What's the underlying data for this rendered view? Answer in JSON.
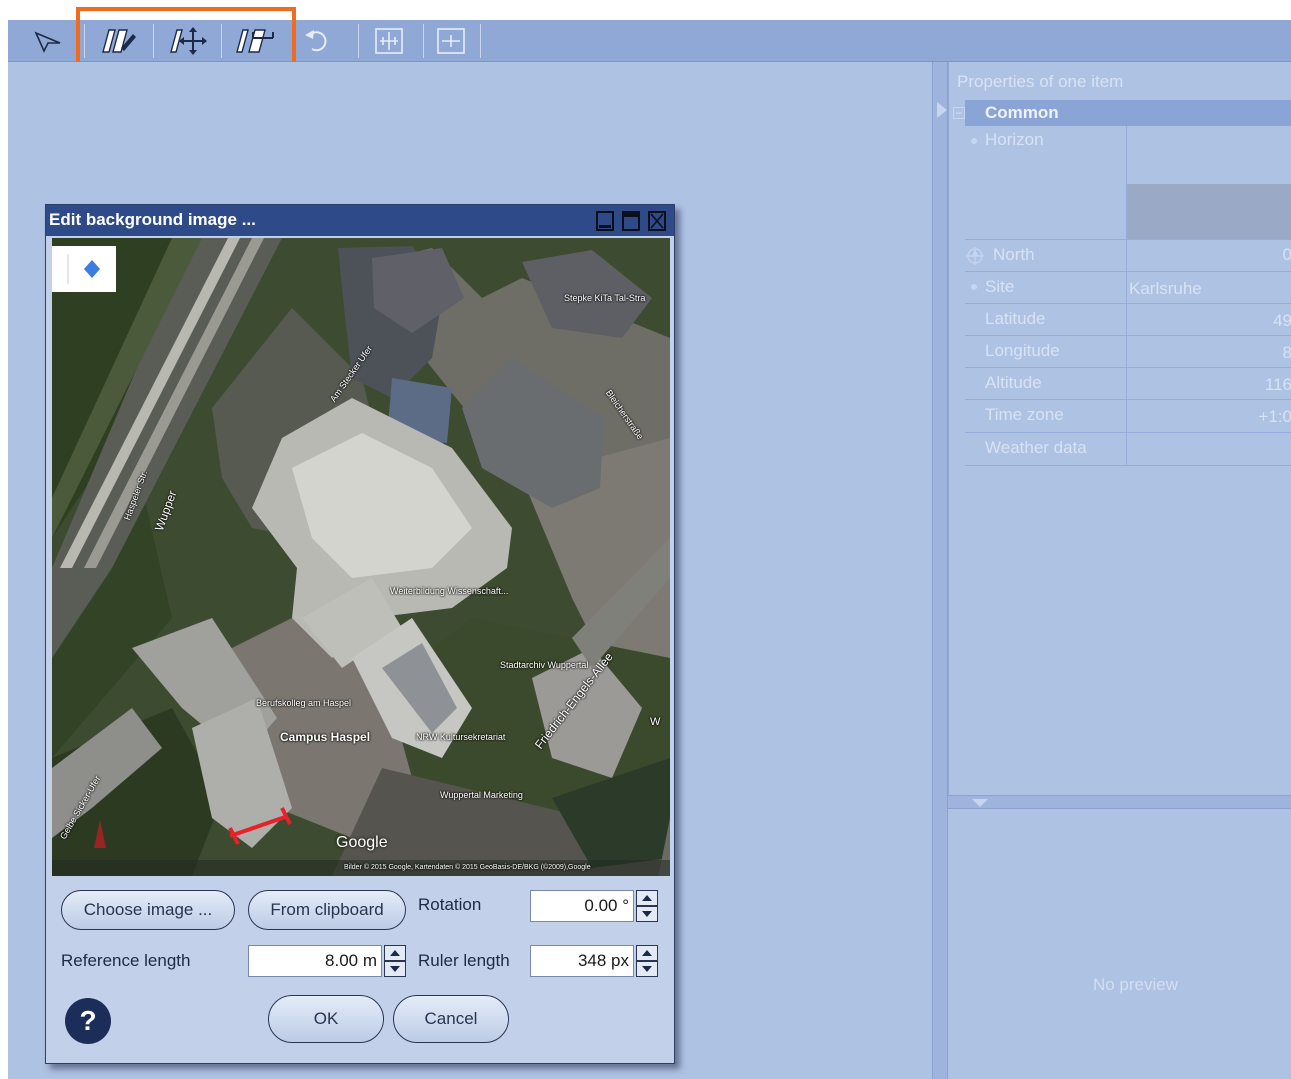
{
  "toolbar": {
    "icons": [
      "select-arrow-icon",
      "draw-wall-icon",
      "move-image-icon",
      "measure-wall-icon",
      "undo-icon",
      "zoom-in-icon",
      "zoom-out-icon"
    ]
  },
  "properties": {
    "title": "Properties of one item",
    "group": "Common",
    "rows": {
      "horizon": "Horizon",
      "north_label": "North",
      "north_value": "0",
      "site_label": "Site",
      "site_value": "Karlsruhe",
      "latitude_label": "Latitude",
      "latitude_value": "49",
      "longitude_label": "Longitude",
      "longitude_value": "8",
      "altitude_label": "Altitude",
      "altitude_value": "116",
      "timezone_label": "Time zone",
      "timezone_value": "+1:0",
      "weather_label": "Weather data"
    }
  },
  "preview": {
    "text": "No preview"
  },
  "dialog": {
    "title": "Edit background image ...",
    "map": {
      "google": "Google",
      "attribution": "Bilder © 2015 Google, Kartendaten © 2015 GeoBasis-DE/BKG (©2009),Google",
      "labels": {
        "stepke": "Stepke KiTa Tal-Stra",
        "weiterbildung": "Weiterbildung Wissenschaft...",
        "stadtarchiv": "Stadtarchiv Wuppertal",
        "berufskolleg": "Berufskolleg am Haspel",
        "campus": "Campus Haspel",
        "kultur": "NRW Kultursekretariat",
        "marketing": "Wuppertal Marketing",
        "friedrich": "Friedrich-Engels-Allee",
        "wupper": "Wupper",
        "haspeler": "Haspeler Str.",
        "sicker": "Gelbe Sicker-Ufer",
        "bleicher": "Bleicherstraße",
        "sitzer": "Am Stecker Ufer",
        "w": "W"
      }
    },
    "choose_image": "Choose image ...",
    "from_clipboard": "From clipboard",
    "rotation_label": "Rotation",
    "rotation_value": "0.00 °",
    "reference_length_label": "Reference length",
    "reference_length_value": "8.00 m",
    "ruler_length_label": "Ruler length",
    "ruler_length_value": "348 px",
    "help": "?",
    "ok": "OK",
    "cancel": "Cancel"
  },
  "colors": {
    "highlight": "#f26a1f",
    "dialog_title": "#2f4a88",
    "workspace": "#aec2e4",
    "ruler": "#e8202a"
  }
}
